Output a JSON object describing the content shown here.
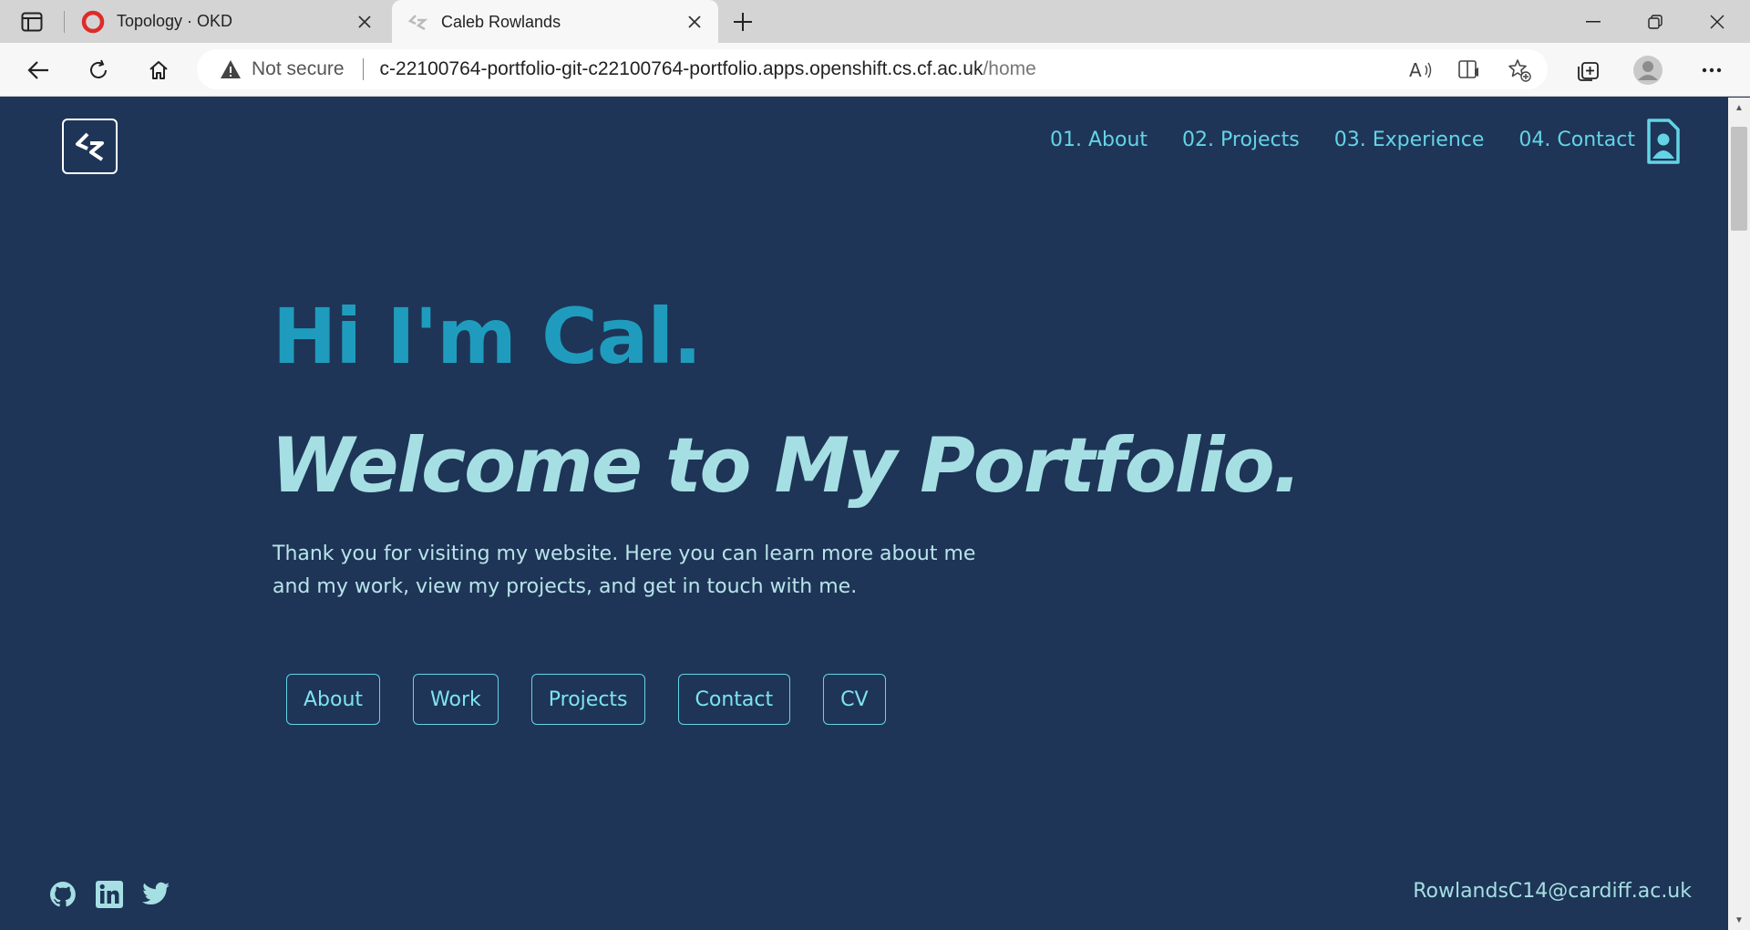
{
  "browser": {
    "tabs": [
      {
        "title": "Topology · OKD",
        "favicon": "okd-red-circle-icon",
        "active": false
      },
      {
        "title": "Caleb Rowlands",
        "favicon": "site-logo-icon",
        "active": true
      }
    ],
    "address": {
      "security_label": "Not secure",
      "url_host": "c-22100764-portfolio-git-c22100764-portfolio.apps.openshift.cs.cf.ac.uk",
      "url_path": "/home"
    }
  },
  "site": {
    "nav": [
      {
        "label": "01. About"
      },
      {
        "label": "02. Projects"
      },
      {
        "label": "03. Experience"
      },
      {
        "label": "04. Contact"
      }
    ],
    "hero": {
      "greeting": "Hi I'm Cal.",
      "headline": "Welcome to My Portfolio.",
      "intro": "Thank you for visiting my website. Here you can learn more about me and my work, view my projects, and get in touch with me."
    },
    "buttons": [
      {
        "label": "About"
      },
      {
        "label": "Work"
      },
      {
        "label": "Projects"
      },
      {
        "label": "Contact"
      },
      {
        "label": "CV"
      }
    ],
    "socials": [
      "github-icon",
      "linkedin-icon",
      "twitter-icon"
    ],
    "email": "RowlandsC14@cardiff.ac.uk"
  },
  "colors": {
    "background": "#1e3557",
    "accent": "#64d3e6",
    "greeting": "#1f9cbd",
    "headline": "#a6dfe3"
  }
}
